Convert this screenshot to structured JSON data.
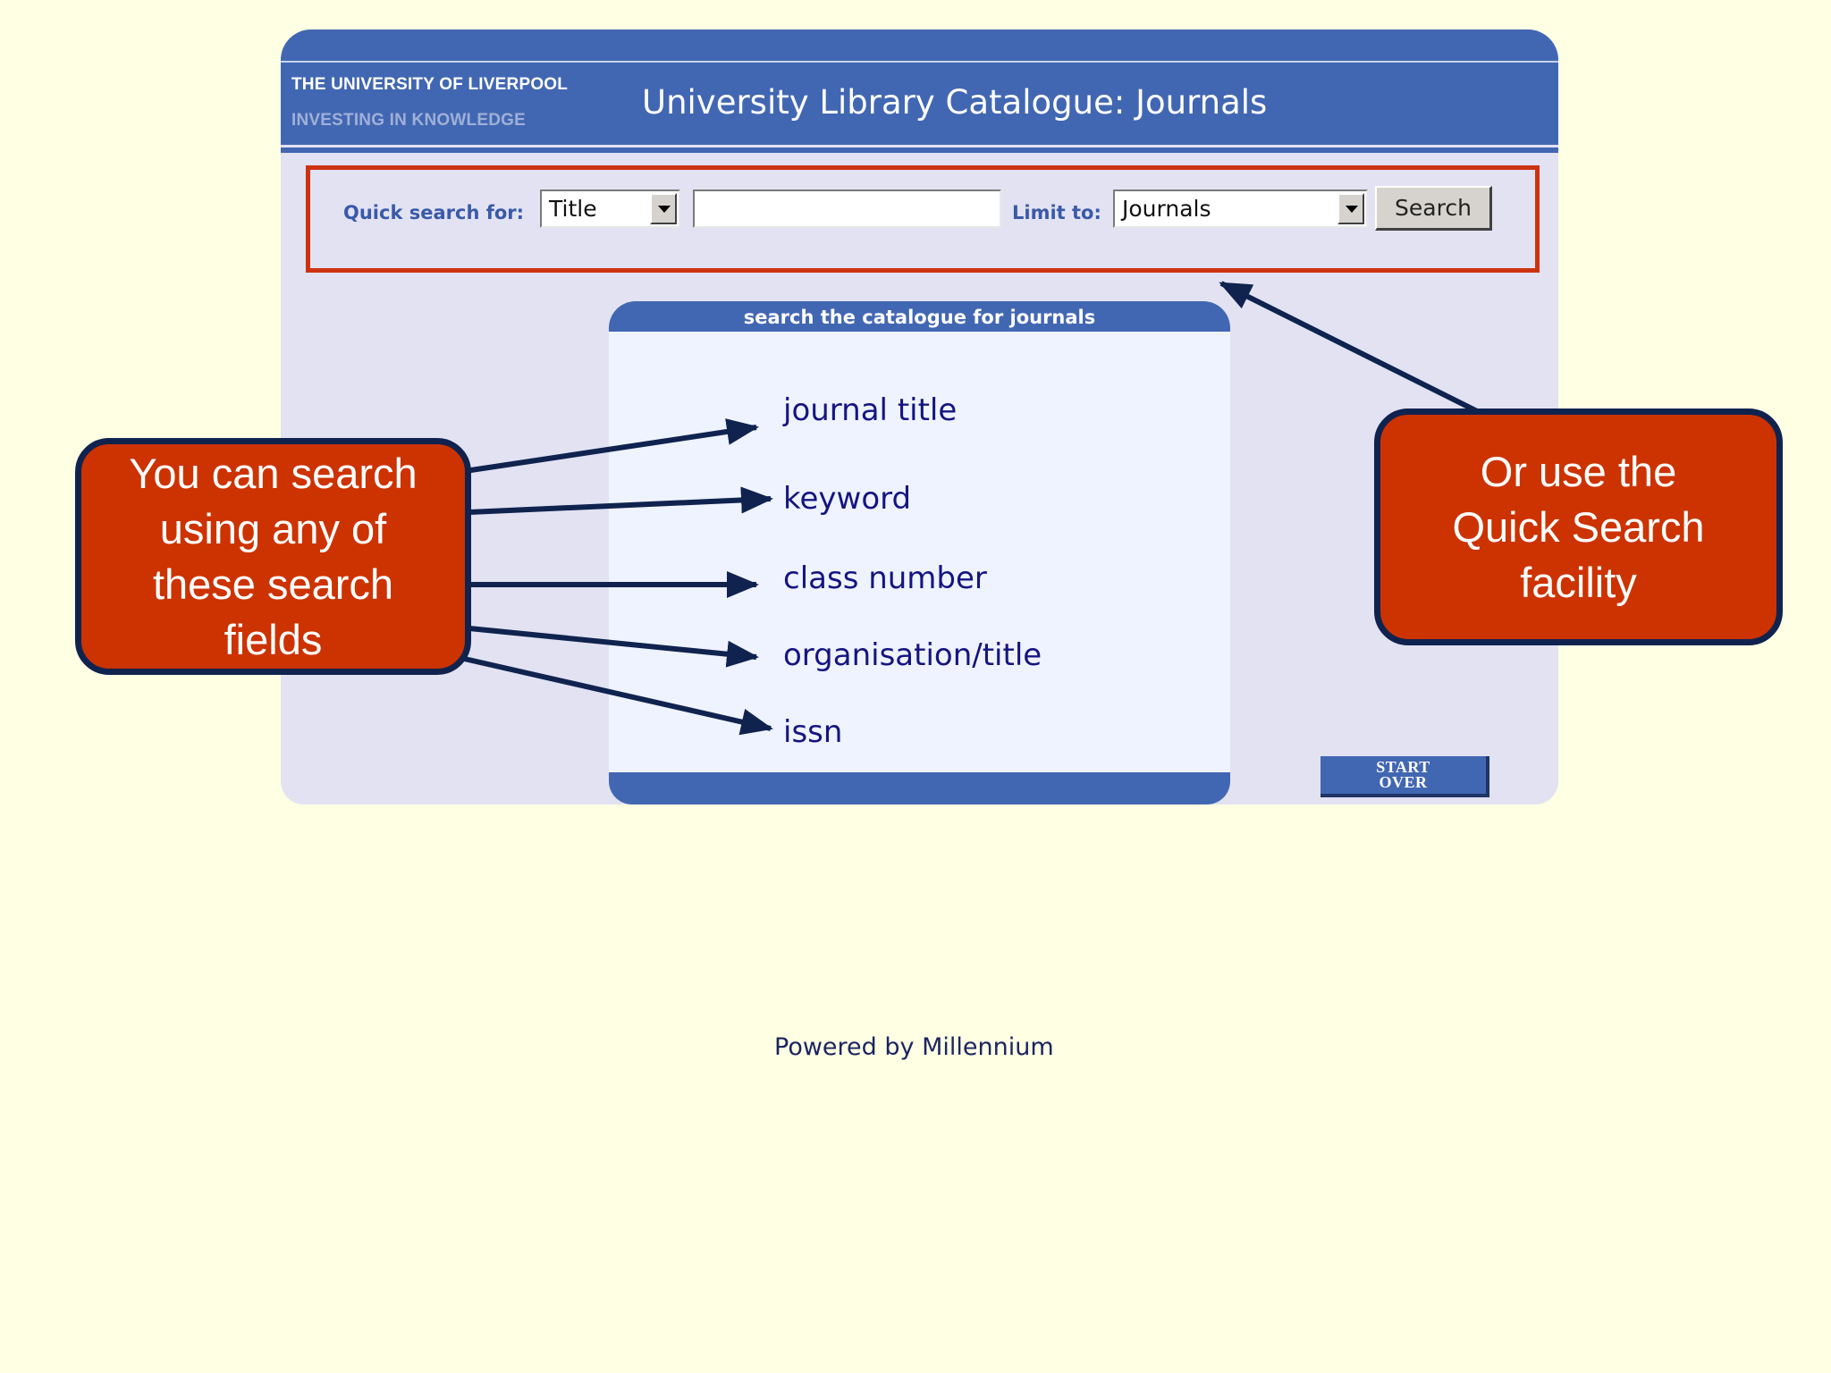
{
  "header": {
    "university_name": "THE UNIVERSITY OF LIVERPOOL",
    "motto": "INVESTING IN KNOWLEDGE",
    "page_title": "University Library Catalogue: Journals"
  },
  "quick_search": {
    "label": "Quick search for:",
    "search_type_value": "Title",
    "search_text_value": "",
    "limit_label": "Limit to:",
    "limit_value": "Journals",
    "search_button": "Search"
  },
  "panel": {
    "title": "search the catalogue for journals",
    "fields": [
      "journal title",
      "keyword",
      "class number",
      "organisation/title",
      "issn"
    ]
  },
  "start_over": {
    "line1": "START",
    "line2": "OVER"
  },
  "footer": {
    "powered_by": "Powered by Millennium"
  },
  "callouts": {
    "left": "You can search using any of these search fields",
    "right": "Or use the Quick Search facility"
  },
  "colors": {
    "page_background": "#ffffe3",
    "header_blue": "#4267b2",
    "frame_background": "#e2e2f3",
    "callout_red": "#cc3300",
    "callout_border": "#10234f",
    "highlight_box": "#cc3311",
    "link_text": "#151580"
  }
}
